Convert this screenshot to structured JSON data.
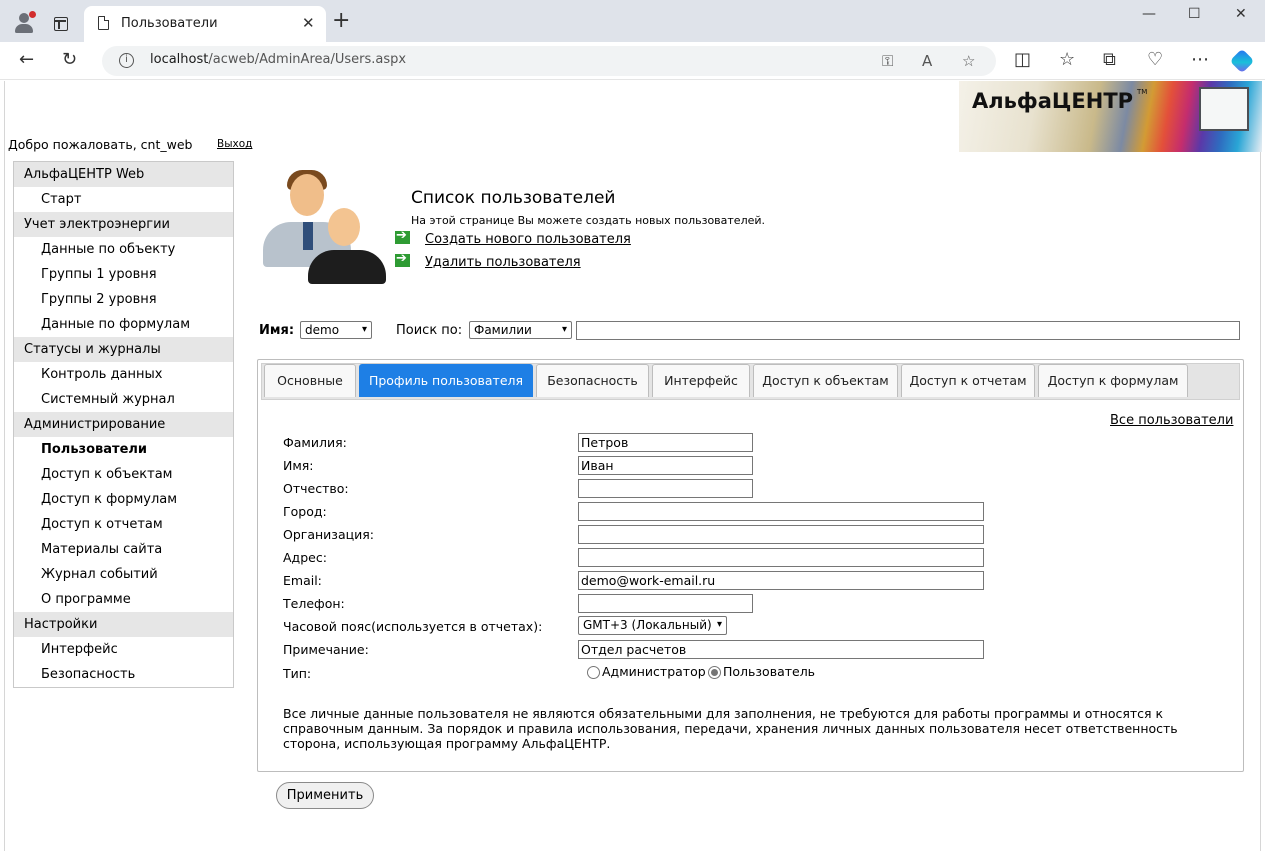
{
  "browser": {
    "tab_title": "Пользователи",
    "tab_close": "✕",
    "new_tab": "+",
    "url_host": "localhost",
    "url_path": "/acweb/AdminArea/Users.aspx",
    "window_controls": [
      "—",
      "☐",
      "✕"
    ]
  },
  "header": {
    "logo_text": "АльфаЦЕНТР",
    "logo_tm": "TM",
    "welcome": "Добро пожаловать, cnt_web",
    "logout": "Выход"
  },
  "sidebar": {
    "sections": [
      {
        "title": "АльфаЦЕНТР Web",
        "items": [
          {
            "label": "Старт"
          }
        ]
      },
      {
        "title": "Учет электроэнергии",
        "items": [
          {
            "label": "Данные по объекту"
          },
          {
            "label": "Группы 1 уровня"
          },
          {
            "label": "Группы 2 уровня"
          },
          {
            "label": "Данные по формулам"
          }
        ]
      },
      {
        "title": "Статусы и журналы",
        "items": [
          {
            "label": "Контроль данных"
          },
          {
            "label": "Системный журнал"
          }
        ]
      },
      {
        "title": "Администрирование",
        "items": [
          {
            "label": "Пользователи",
            "active": true
          },
          {
            "label": "Доступ к объектам"
          },
          {
            "label": "Доступ к формулам"
          },
          {
            "label": "Доступ к отчетам"
          },
          {
            "label": "Материалы сайта"
          },
          {
            "label": "Журнал событий"
          },
          {
            "label": "О программе"
          }
        ]
      },
      {
        "title": "Настройки",
        "items": [
          {
            "label": "Интерфейс"
          },
          {
            "label": "Безопасность"
          }
        ]
      }
    ]
  },
  "main": {
    "title": "Список пользователей",
    "description": "На этой странице Вы можете создать новых пользователей.",
    "actions": {
      "create": "Создать нового пользователя",
      "delete": "Удалить пользователя"
    },
    "search": {
      "name_label": "Имя:",
      "name_value": "demo",
      "search_label": "Поиск по:",
      "search_by_value": "Фамилии",
      "search_text": ""
    },
    "tabs": [
      {
        "label": "Основные"
      },
      {
        "label": "Профиль пользователя",
        "active": true
      },
      {
        "label": "Безопасность"
      },
      {
        "label": "Интерфейс"
      },
      {
        "label": "Доступ к объектам"
      },
      {
        "label": "Доступ к отчетам"
      },
      {
        "label": "Доступ к формулам"
      }
    ],
    "all_users_link": "Все пользователи",
    "form": {
      "last_name": {
        "label": "Фамилия:",
        "value": "Петров"
      },
      "first_name": {
        "label": "Имя:",
        "value": "Иван"
      },
      "patronymic": {
        "label": "Отчество:",
        "value": ""
      },
      "city": {
        "label": "Город:",
        "value": ""
      },
      "organization": {
        "label": "Организация:",
        "value": ""
      },
      "address": {
        "label": "Адрес:",
        "value": ""
      },
      "email": {
        "label": "Email:",
        "value": "demo@work-email.ru"
      },
      "phone": {
        "label": "Телефон:",
        "value": ""
      },
      "timezone": {
        "label": "Часовой пояс(используется в отчетах):",
        "value": "GMT+3 (Локальный)"
      },
      "note": {
        "label": "Примечание:",
        "value": "Отдел расчетов"
      },
      "type": {
        "label": "Тип:",
        "option_admin": "Администратор",
        "option_user": "Пользователь",
        "selected": "Пользователь"
      }
    },
    "disclaimer": "Все личные данные пользователя не являются обязательными для заполнения, не требуются для работы программы и относятся к справочным данным. За порядок и правила использования, передачи, хранения личных данных пользователя несет ответственность сторона, использующая программу АльфаЦЕНТР.",
    "apply_button": "Применить"
  },
  "colors": {
    "active_tab": "#1e7fe5",
    "section_bg": "#e6e6e6",
    "action_icon": "#2e9b33"
  }
}
